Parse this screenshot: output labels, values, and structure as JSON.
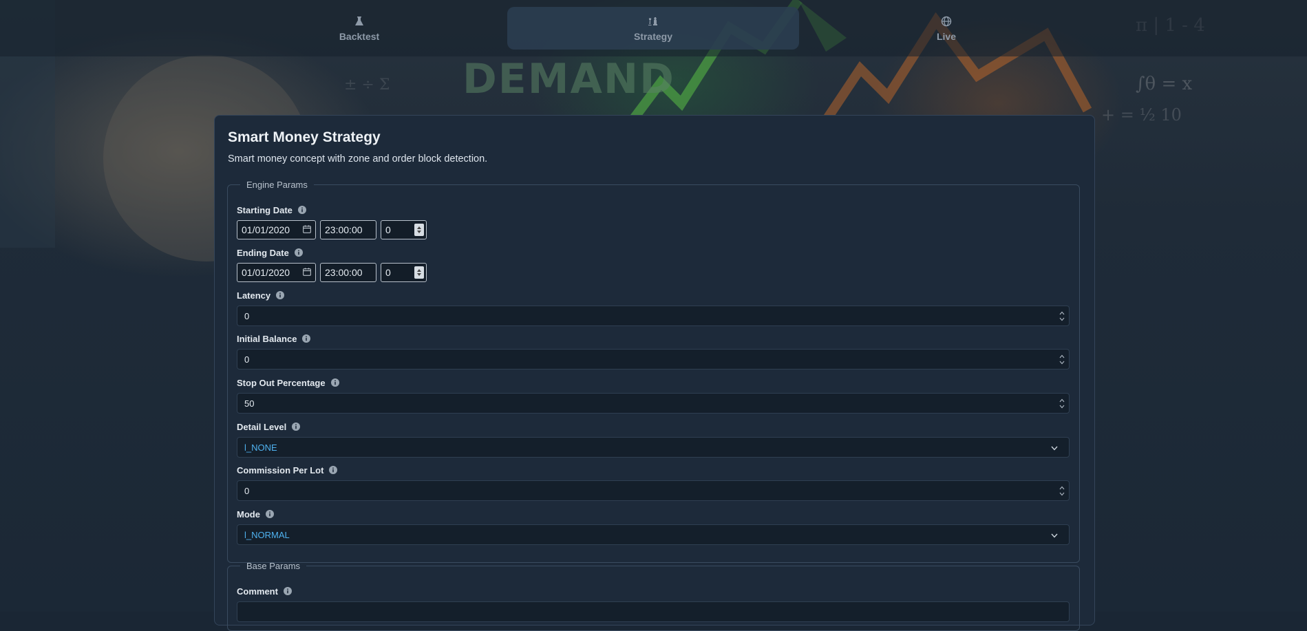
{
  "nav": {
    "tabs": [
      {
        "label": "Backtest",
        "icon": "flask-icon",
        "active": false
      },
      {
        "label": "Strategy",
        "icon": "chess-icon",
        "active": true
      },
      {
        "label": "Live",
        "icon": "globe-icon",
        "active": false
      }
    ]
  },
  "background": {
    "text": "DEMAND"
  },
  "strategy": {
    "title": "Smart Money Strategy",
    "description": "Smart money concept with zone and order block detection."
  },
  "engine_params": {
    "legend": "Engine Params",
    "starting_date": {
      "label": "Starting Date",
      "month": "01",
      "day": "01",
      "year": "2020",
      "hour": "23",
      "minute": "00",
      "second": "00",
      "extra": "0"
    },
    "ending_date": {
      "label": "Ending Date",
      "month": "01",
      "day": "01",
      "year": "2020",
      "hour": "23",
      "minute": "00",
      "second": "00",
      "extra": "0"
    },
    "latency": {
      "label": "Latency",
      "value": "0"
    },
    "initial_balance": {
      "label": "Initial Balance",
      "value": "0"
    },
    "stop_out_percentage": {
      "label": "Stop Out Percentage",
      "value": "50"
    },
    "detail_level": {
      "label": "Detail Level",
      "value": "l_NONE"
    },
    "commission_per_lot": {
      "label": "Commission Per Lot",
      "value": "0"
    },
    "mode": {
      "label": "Mode",
      "value": "l_NORMAL"
    }
  },
  "base_params": {
    "legend": "Base Params",
    "comment": {
      "label": "Comment",
      "value": ""
    }
  },
  "colors": {
    "accent": "#4fb2f0",
    "card": "#1d2a3a",
    "input": "#141f2b"
  }
}
